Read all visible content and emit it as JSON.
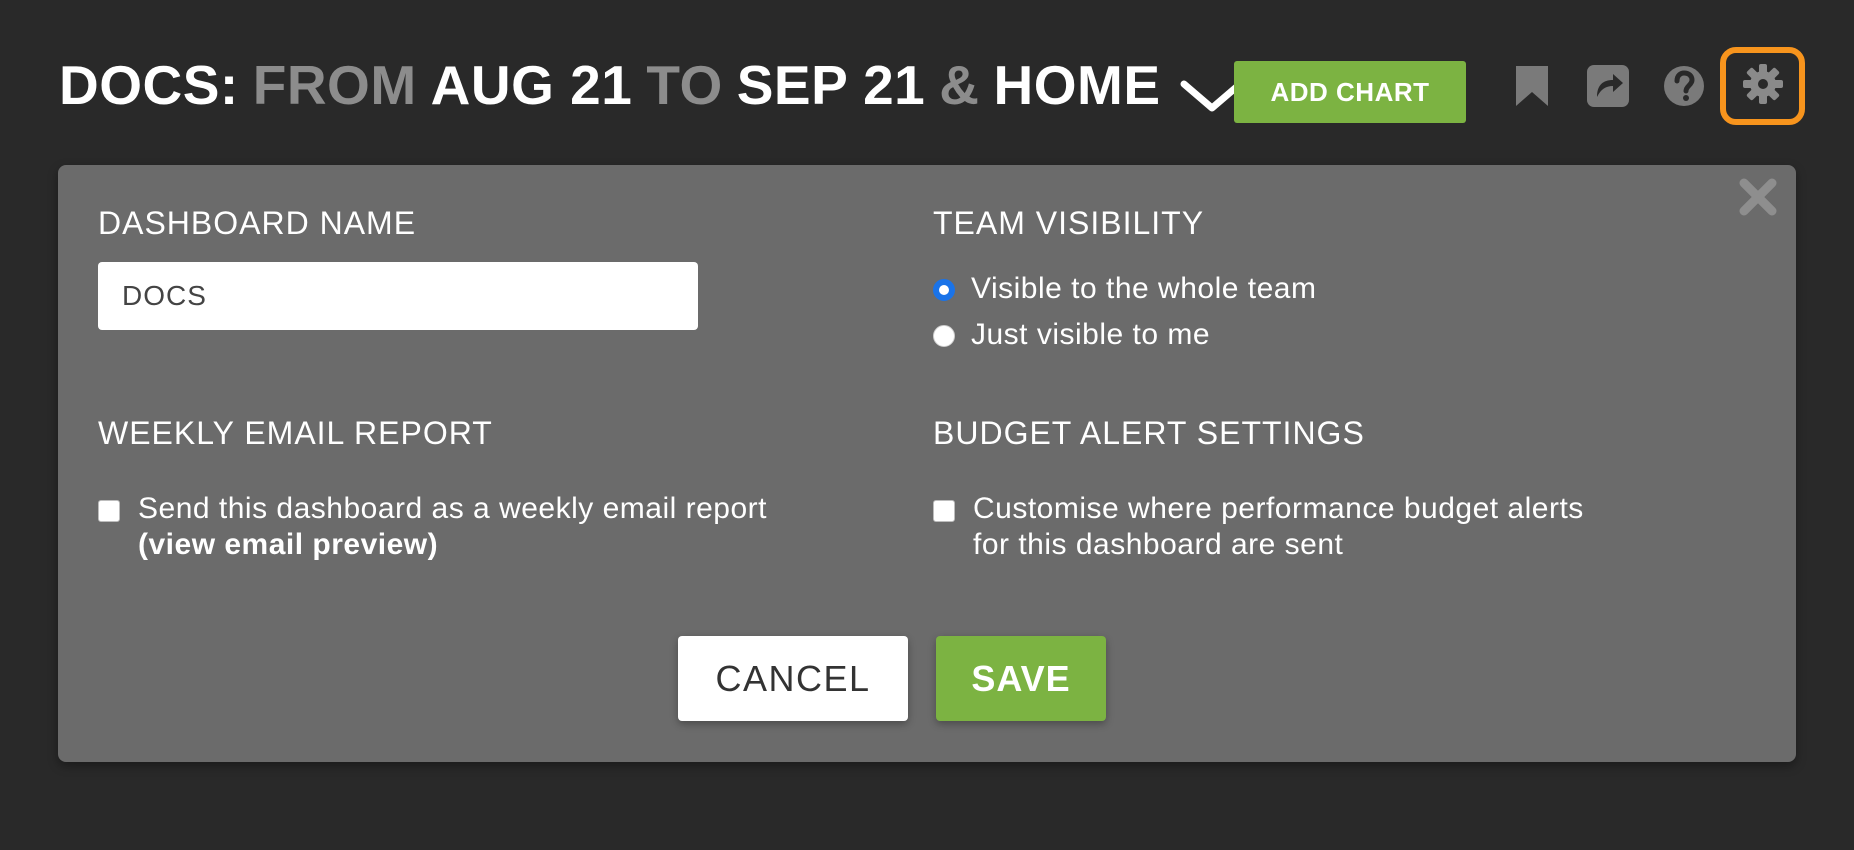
{
  "header": {
    "prefix": "DOCS:",
    "from_word": "FROM",
    "from_date": "AUG 21",
    "to_word": "TO",
    "to_date": "SEP 21",
    "amp": "&",
    "page": "HOME",
    "add_chart_label": "ADD CHART",
    "icons": [
      "bookmark-icon",
      "share-icon",
      "help-icon",
      "settings-icon"
    ],
    "accent_color": "#f7941d"
  },
  "panel": {
    "dashboard_name": {
      "title": "DASHBOARD NAME",
      "value": "DOCS"
    },
    "team_visibility": {
      "title": "TEAM VISIBILITY",
      "options": [
        {
          "label": "Visible to the whole team",
          "selected": true
        },
        {
          "label": "Just visible to me",
          "selected": false
        }
      ]
    },
    "weekly_email": {
      "title": "WEEKLY EMAIL REPORT",
      "checkbox_label": "Send this dashboard as a weekly email report",
      "preview_link": "(view email preview)",
      "checked": false
    },
    "budget_alerts": {
      "title": "BUDGET ALERT SETTINGS",
      "checkbox_label_line1": "Customise where performance budget alerts",
      "checkbox_label_line2": "for this dashboard are sent",
      "checked": false
    },
    "cancel_label": "CANCEL",
    "save_label": "SAVE"
  },
  "colors": {
    "background": "#292929",
    "panel": "#6b6b6b",
    "green": "#7cb342",
    "radio_blue": "#1a73e8"
  }
}
